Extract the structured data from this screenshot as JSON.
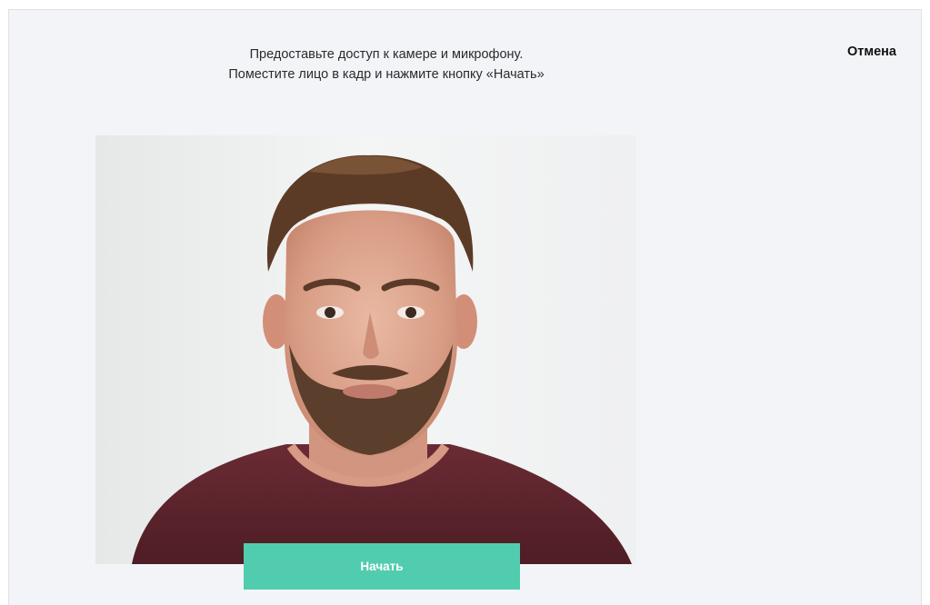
{
  "header": {
    "instruction_line1": "Предоставьте доступ к камере и микрофону.",
    "instruction_line2": "Поместите лицо в кадр и нажмите кнопку «Начать»",
    "cancel_label": "Отмена"
  },
  "camera": {
    "description": "camera-preview"
  },
  "actions": {
    "start_label": "Начать"
  },
  "colors": {
    "background": "#f3f4f8",
    "accent": "#52ccaf",
    "text": "#2b2b2b"
  }
}
